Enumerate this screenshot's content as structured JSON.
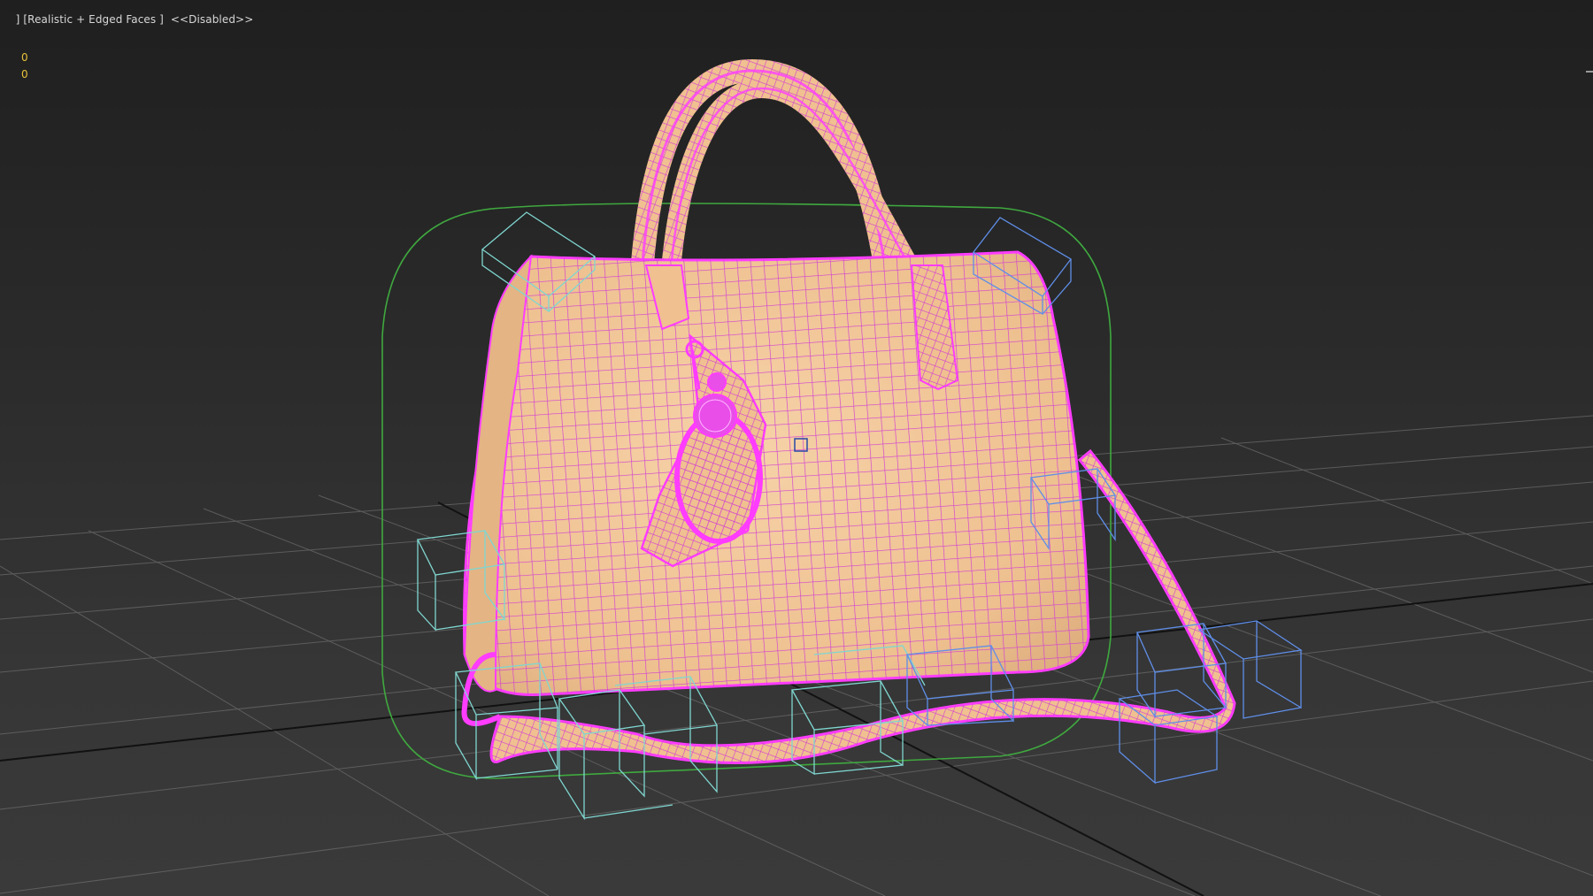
{
  "viewport": {
    "pov_bracket": "]",
    "shading_mode": "[Realistic + Edged Faces ]",
    "state": "<<Disabled>>"
  },
  "stats": {
    "line1": "0",
    "line2": "0"
  },
  "colors": {
    "background_top": "#1f1f1f",
    "background_bottom": "#3a3a3a",
    "grid": "#6a6a6a",
    "grid_main_axis": "#111111",
    "mesh_fill": "#f2c79a",
    "wire": "#d13ed1",
    "wire_highlight": "#ff3cff",
    "collision_envelope": "#3fa83f",
    "helper_cyan": "#7fd6d0",
    "helper_blue": "#5f8ee8",
    "stats_text": "#e8c23a"
  },
  "scene": {
    "object": "handbag-mesh",
    "helpers": "box-helpers"
  }
}
